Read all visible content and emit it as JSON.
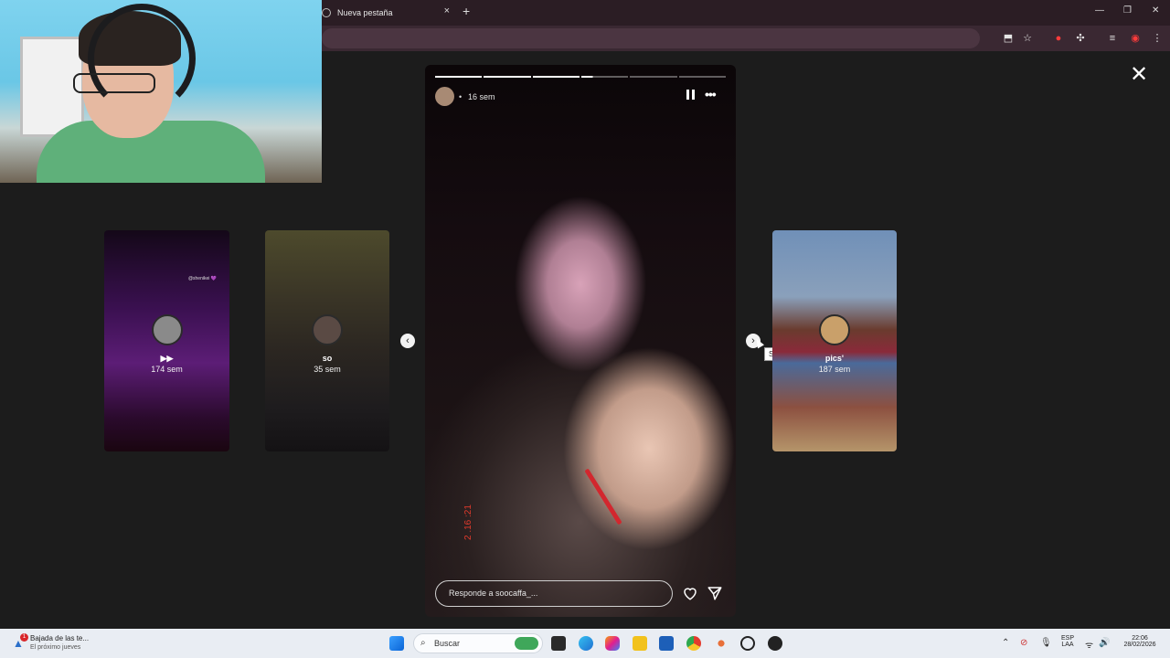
{
  "browser": {
    "tab_title": "Nueva pestaña",
    "tab_close": "×",
    "new_tab": "+",
    "window_controls": [
      "—",
      "❐",
      "✕"
    ]
  },
  "viewer": {
    "close_label": "✕",
    "prev_label": "‹",
    "next_label": "›",
    "next_tooltip": "Siguiente",
    "side_stories": [
      {
        "handle": "@shenikei 💜",
        "username": "",
        "age": "174 sem",
        "icon": "▶▶"
      },
      {
        "username": "so",
        "age": "35 sem"
      },
      {
        "username": "pics'",
        "age": "187 sem"
      }
    ],
    "main_story": {
      "dot": "•",
      "age": "16 sem",
      "more_label": "•••",
      "reply_placeholder": "Responde a soocaffa_...",
      "stamp_text": "2 .16 :21",
      "progress_segments": 6,
      "progress_current": 4,
      "progress_fraction_in_current": 0.25
    }
  },
  "taskbar": {
    "notification_title": "Bajada de las te...",
    "notification_subtitle": "El próximo jueves",
    "notification_badge": "1",
    "search_label": "Buscar",
    "language_line1": "ESP",
    "language_line2": "LAA",
    "time": "22:06",
    "date": "28/02/2026"
  },
  "colors": {
    "viewer_bg": "#1c1c1c",
    "tabbar_bg": "#2b1d24",
    "taskbar_bg": "#e9edf3",
    "bracelet": "#d2272e"
  }
}
